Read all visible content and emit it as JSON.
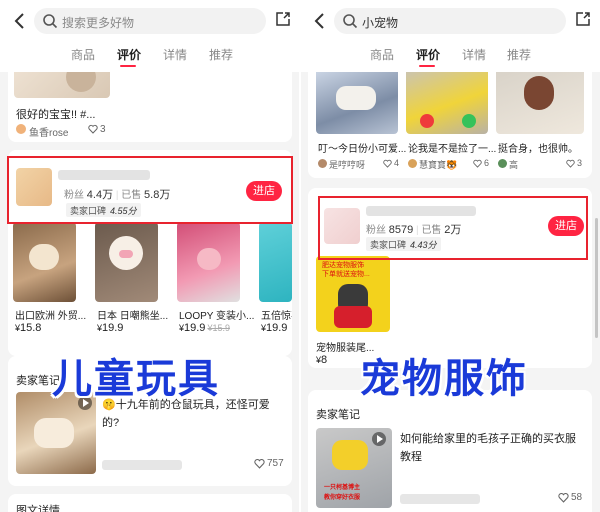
{
  "left": {
    "search": {
      "placeholder": "搜索更多好物"
    },
    "tabs": [
      "商品",
      "评价",
      "详情",
      "推荐"
    ],
    "review": {
      "text": "很好的宝宝!! #...",
      "user": "鱼香rose",
      "likes": "3"
    },
    "shop": {
      "fans_label": "粉丝",
      "fans": "4.4万",
      "sold_label": "已售",
      "sold": "5.8万",
      "rating_label": "卖家口碑",
      "rating": "4.55分",
      "enter_label": "进店"
    },
    "products": [
      {
        "title": "出口欧洲 外贸...",
        "cur": "¥",
        "price": "15.8",
        "old": ""
      },
      {
        "title": "日本 日嘲熊坐...",
        "cur": "¥",
        "price": "19.9",
        "old": ""
      },
      {
        "title": "LOOPY 变装小...",
        "cur": "¥",
        "price": "19.9",
        "old": "¥15.9"
      },
      {
        "title": "五倍惊喜",
        "cur": "¥",
        "price": "19.9",
        "old": ""
      }
    ],
    "overlay": "儿童玩具",
    "notes": {
      "title": "卖家笔记",
      "text_line1": "🤫十九年前的仓鼠玩具，还怪可爱",
      "text_line2": "的?",
      "likes": "757"
    },
    "bottom": "图文详情"
  },
  "right": {
    "search": {
      "value": "小宠物"
    },
    "tabs": [
      "商品",
      "评价",
      "详情",
      "推荐"
    ],
    "reviews": [
      {
        "text": "叮～今日份小可爱...",
        "user": "是哼哼呀",
        "likes": "4"
      },
      {
        "text": "论我是不是捡了一...",
        "user": "慧寶寶🐯",
        "likes": "6"
      },
      {
        "text": "挺合身，也很帅。",
        "user": "高",
        "likes": "3"
      }
    ],
    "shop": {
      "fans_label": "粉丝",
      "fans": "8579",
      "sold_label": "已售",
      "sold": "2万",
      "rating_label": "卖家口碑",
      "rating": "4.43分",
      "enter_label": "进店"
    },
    "product": {
      "img_line1": "肥达宠物服饰",
      "img_line2": "下单就送宠物...",
      "title": "宠物服装尾...",
      "cur": "¥",
      "price": "8"
    },
    "overlay": "宠物服饰",
    "notes": {
      "title": "卖家笔记",
      "text_line1": "如何能给家里的毛孩子正确的买衣服",
      "text_line2": "教程",
      "badge_line1": "一只柯基博主",
      "badge_line2": "教你穿好衣服",
      "likes": "58"
    }
  },
  "colors": {
    "accent": "#ff2442",
    "overlay": "#1a3ad8",
    "frame": "#e8232e"
  }
}
